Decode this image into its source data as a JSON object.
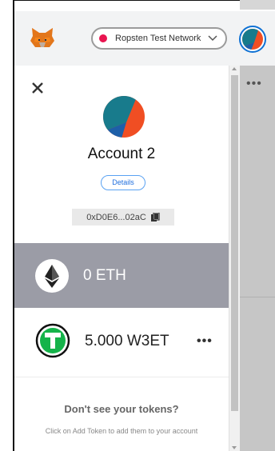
{
  "header": {
    "network_label": "Ropsten Test Network",
    "network_color": "#e91550"
  },
  "account": {
    "name": "Account 2",
    "details_label": "Details",
    "address": "0xD0E6...02aC"
  },
  "assets": [
    {
      "amount_label": "0 ETH",
      "icon": "ethereum-icon"
    },
    {
      "amount_label": "5.000 W3ET",
      "icon": "token-t-icon"
    }
  ],
  "tokens_hint": {
    "title": "Don't see your tokens?",
    "body": "Click on Add Token to add them to your account"
  },
  "colors": {
    "accent": "#0f71d4",
    "eth_row": "#9b9ca6",
    "token_green": "#15b34a"
  }
}
